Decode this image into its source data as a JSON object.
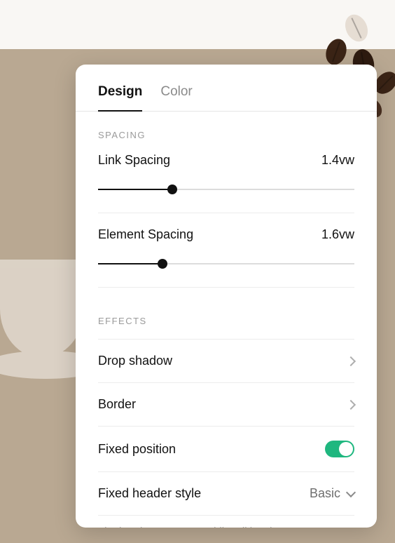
{
  "tabs": {
    "design": "Design",
    "color": "Color"
  },
  "spacing": {
    "section_label": "SPACING",
    "link": {
      "label": "Link Spacing",
      "value": "1.4vw",
      "percent": 29
    },
    "element": {
      "label": "Element Spacing",
      "value": "1.6vw",
      "percent": 25
    }
  },
  "effects": {
    "section_label": "EFFECTS",
    "drop_shadow": "Drop shadow",
    "border": "Border",
    "fixed_position": {
      "label": "Fixed position",
      "enabled": true
    },
    "fixed_header_style": {
      "label": "Fixed header style",
      "value": "Basic"
    },
    "hint": "The header may move while editing the page"
  },
  "colors": {
    "accent": "#1fb77f"
  }
}
